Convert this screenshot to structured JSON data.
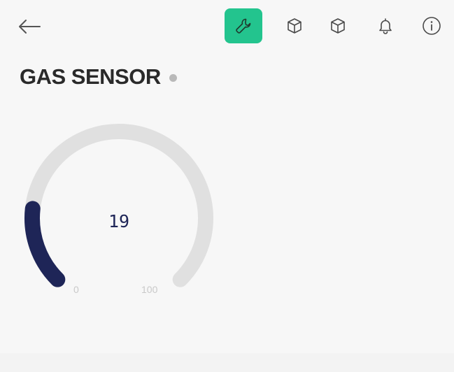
{
  "header": {
    "icons": [
      "back-arrow-icon",
      "wrench-icon",
      "cube-icon",
      "cube-icon",
      "bell-icon",
      "info-icon"
    ]
  },
  "device": {
    "title": "GAS SENSOR",
    "status": "offline"
  },
  "gauge": {
    "value": "19",
    "min": "0",
    "max": "100",
    "value_number": 19,
    "min_number": 0,
    "max_number": 100,
    "track_color": "#e0e0e0",
    "fill_color": "#1e2557"
  },
  "colors": {
    "accent": "#23c48e",
    "icon": "#4a4a4a",
    "title": "#2a2a2a"
  }
}
